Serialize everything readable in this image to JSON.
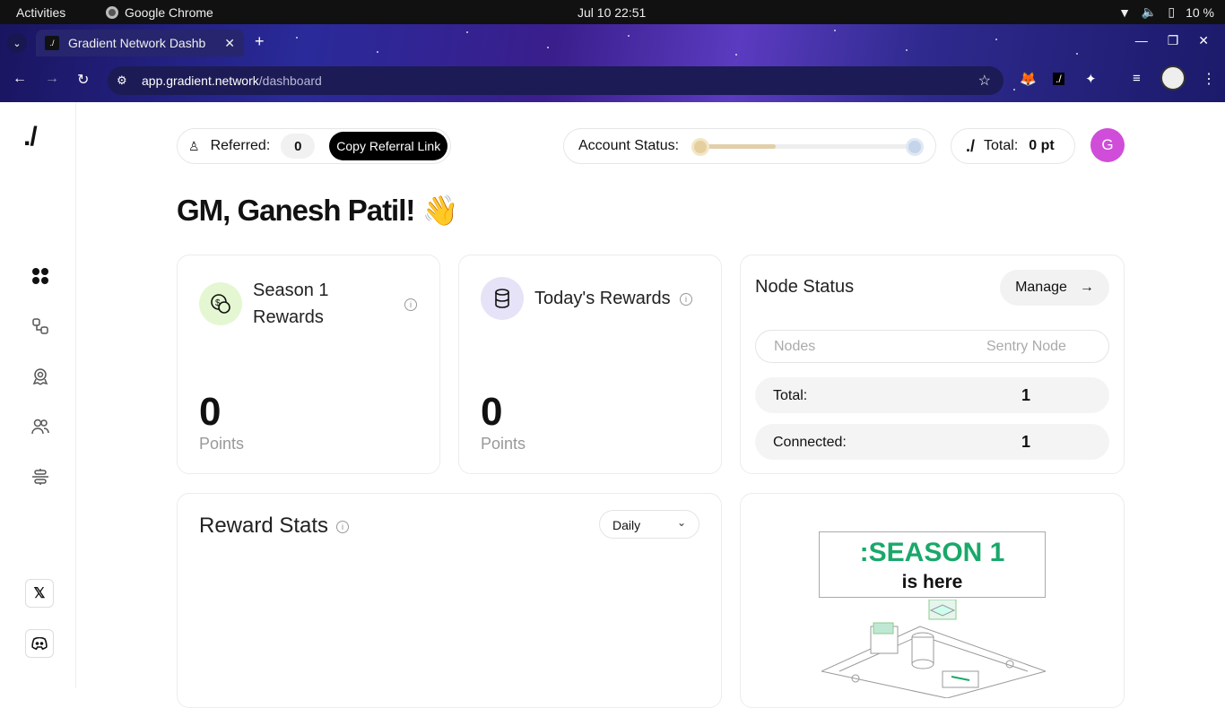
{
  "system": {
    "activities": "Activities",
    "app": "Google Chrome",
    "clock": "Jul 10  22:51",
    "battery": "10 %"
  },
  "browser": {
    "tab_title": "Gradient Network Dashb",
    "url_host": "app.gradient.network",
    "url_path": "/dashboard"
  },
  "header": {
    "referred_label": "Referred:",
    "referred_count": "0",
    "copy_referral": "Copy Referral Link",
    "account_status_label": "Account Status:",
    "account_status_progress": 0.35,
    "total_logo": "./",
    "total_label": "Total:",
    "total_value": "0 pt",
    "avatar_initial": "G"
  },
  "sidebar": {
    "logo": "./"
  },
  "greeting": "GM, Ganesh Patil! 👋",
  "season": {
    "title_line1": "Season 1",
    "title_line2": "Rewards",
    "value": "0",
    "unit": "Points"
  },
  "today": {
    "title": "Today's Rewards",
    "value": "0",
    "unit": "Points"
  },
  "node_status": {
    "title": "Node Status",
    "manage": "Manage",
    "col1": "Nodes",
    "col2": "Sentry Node",
    "rows": [
      {
        "label": "Total:",
        "value": "1"
      },
      {
        "label": "Connected:",
        "value": "1"
      }
    ]
  },
  "reward_stats": {
    "title": "Reward Stats",
    "period": "Daily"
  },
  "banner": {
    "season": ":SEASON 1",
    "here": "is here"
  },
  "colors": {
    "accent": "#1aa86a",
    "avatar": "#cf4dd8"
  }
}
